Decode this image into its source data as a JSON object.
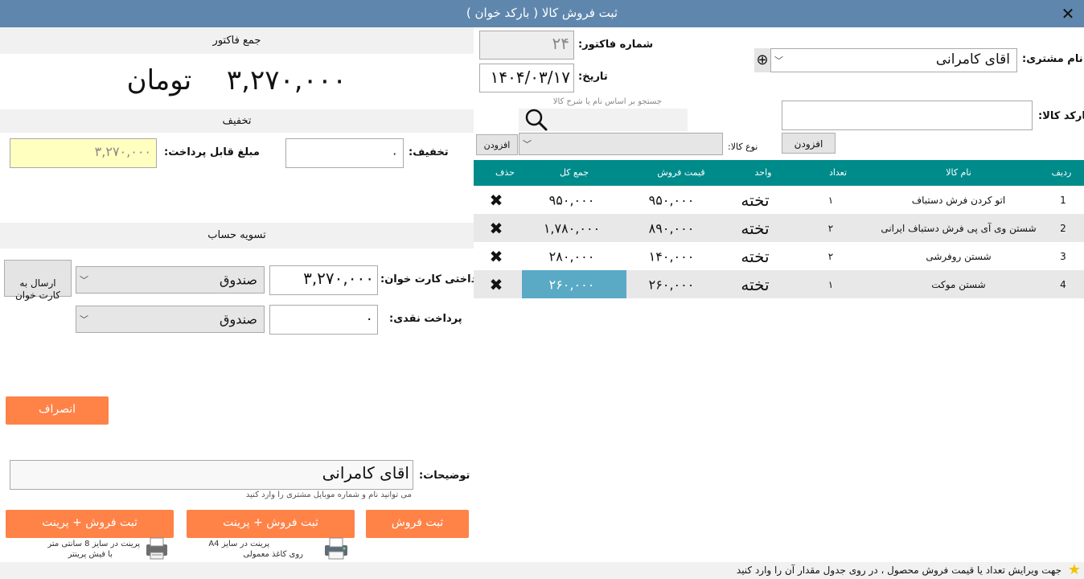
{
  "window": {
    "title": "ثبت فروش کالا ( بارکد خوان )",
    "close_glyph": "✕"
  },
  "invoice_summary": {
    "header": "جمع فاکتور",
    "total_amount": "۳,۲۷۰,۰۰۰",
    "currency": "تومان"
  },
  "discount_section": {
    "header": "تخفیف",
    "discount_label": "تخفیف:",
    "discount_value": "۰",
    "payable_label": "مبلغ قابل پرداخت:",
    "payable_value": "۳,۲۷۰,۰۰۰"
  },
  "settlement": {
    "header": "تسویه حساب",
    "card_label": "پرداختی کارت خوان:",
    "card_value": "۳,۲۷۰,۰۰۰",
    "card_account": "صندوق",
    "send_to_card_label": "ارسال به\nکارت خوان",
    "cash_label": "پرداخت نقدی:",
    "cash_value": "۰",
    "cash_account": "صندوق",
    "cancel_label": "انصراف"
  },
  "description": {
    "label": "توضیحات:",
    "value": "اقای کامرانی",
    "hint": "می توانید نام و شماره موبایل مشتری را وارد کنید"
  },
  "actions": {
    "save_label": "ثبت فروش",
    "save_print_a4_label": "ثبت فروش + پرینت",
    "save_print_a4_hint_1": "پرینت در سایز A4",
    "save_print_a4_hint_2": "روی کاغذ معمولی",
    "save_print_8cm_label": "ثبت فروش + پرینت",
    "save_print_8cm_hint_1": "پرینت در سایز 8 سانتی متر",
    "save_print_8cm_hint_2": "با فیش پرینتر"
  },
  "customer": {
    "label": "نام مشتری:",
    "value": "اقای کامرانی",
    "add_glyph": "⊕"
  },
  "invoice": {
    "number_label": "شماره فاکتور:",
    "number_value": "۲۴",
    "date_label": "تاریخ:",
    "date_value": "۱۴۰۴/۰۳/۱۷"
  },
  "barcode": {
    "label": "بارکد کالا:",
    "value": "",
    "add_label": "افزودن"
  },
  "search": {
    "hint": "جستجو بر اساس نام یا شرح کالا",
    "value": ""
  },
  "product_type": {
    "label": "نوع کالا:",
    "value": "",
    "add_label": "افزودن"
  },
  "table": {
    "headers": {
      "idx": "ردیف",
      "name": "نام کالا",
      "qty": "تعداد",
      "unit": "واحد",
      "price": "قیمت فروش",
      "total": "جمع کل",
      "del": "حذف"
    },
    "rows": [
      {
        "idx": "1",
        "name": "اتو کردن فرش دستباف",
        "qty": "۱",
        "unit": "تخته",
        "price": "۹۵۰,۰۰۰",
        "total": "۹۵۰,۰۰۰",
        "del": "✖"
      },
      {
        "idx": "2",
        "name": "شستن وی آی پی فرش دستباف ایرانی",
        "qty": "۲",
        "unit": "تخته",
        "price": "۸۹۰,۰۰۰",
        "total": "۱,۷۸۰,۰۰۰",
        "del": "✖"
      },
      {
        "idx": "3",
        "name": "شستن روفرشی",
        "qty": "۲",
        "unit": "تخته",
        "price": "۱۴۰,۰۰۰",
        "total": "۲۸۰,۰۰۰",
        "del": "✖"
      },
      {
        "idx": "4",
        "name": "شستن موکت",
        "qty": "۱",
        "unit": "تخته",
        "price": "۲۶۰,۰۰۰",
        "total": "۲۶۰,۰۰۰",
        "del": "✖"
      }
    ]
  },
  "footer": {
    "tip": "جهت ویرایش تعداد یا قیمت فروش محصول ، در روی جدول مقدار آن را وارد کنید",
    "star_glyph": "★"
  },
  "colors": {
    "titlebar": "#5f87ad",
    "accent_orange": "#ff8247",
    "table_header": "#008b8b",
    "highlight_cell": "#5aa9c5",
    "payable_bg": "#ffffc0"
  }
}
